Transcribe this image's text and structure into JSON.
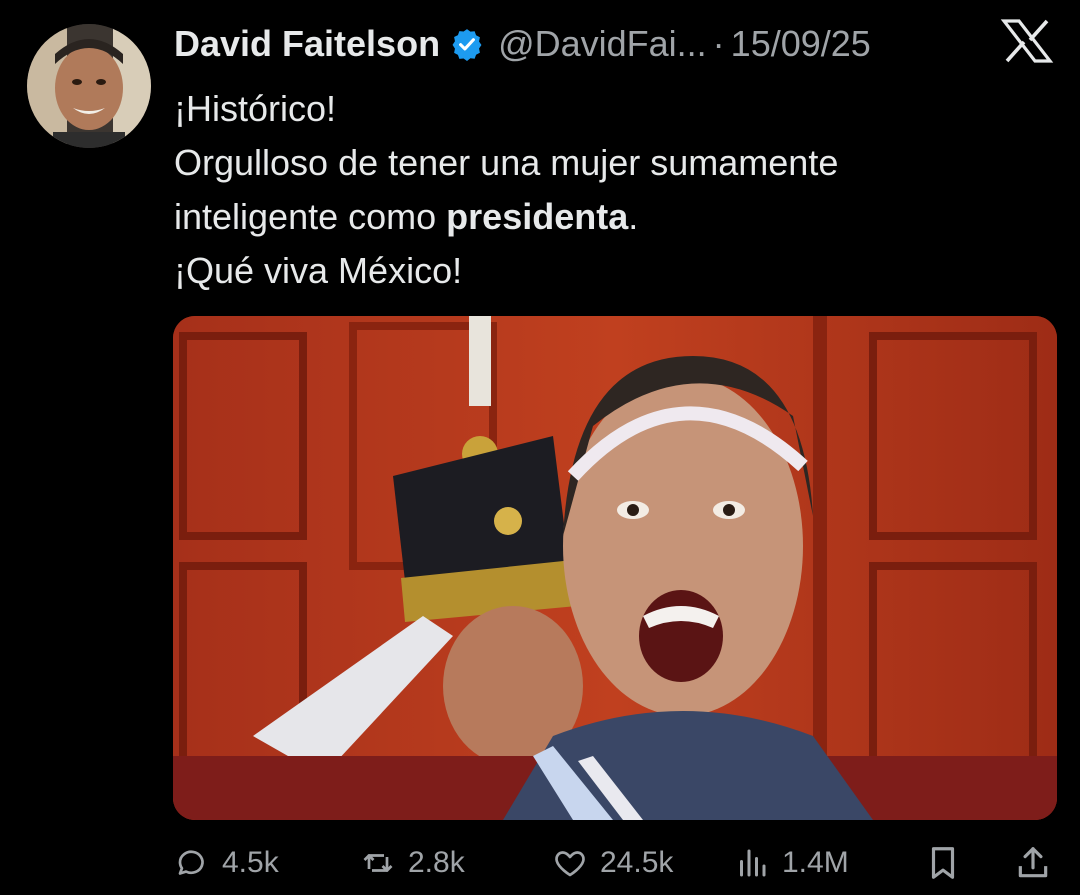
{
  "author": {
    "display_name": "David Faitelson",
    "handle": "@DavidFai...",
    "separator": "·",
    "date": "15/09/25"
  },
  "tweet": {
    "line1": "¡Histórico!",
    "line2": "Orgulloso de tener una mujer sumamente",
    "line3_pre": "inteligente como ",
    "line3_bold": "presidenta",
    "line3_post": ".",
    "line4": "¡Qué viva México!"
  },
  "media": {
    "icon": "photo"
  },
  "actions": {
    "replies": "4.5k",
    "reposts": "2.8k",
    "likes": "24.5k",
    "views": "1.4M"
  },
  "colors": {
    "background": "#000000",
    "text": "#e7e9ea",
    "muted": "#a0a4a8",
    "verified": "#1d9bf0"
  }
}
